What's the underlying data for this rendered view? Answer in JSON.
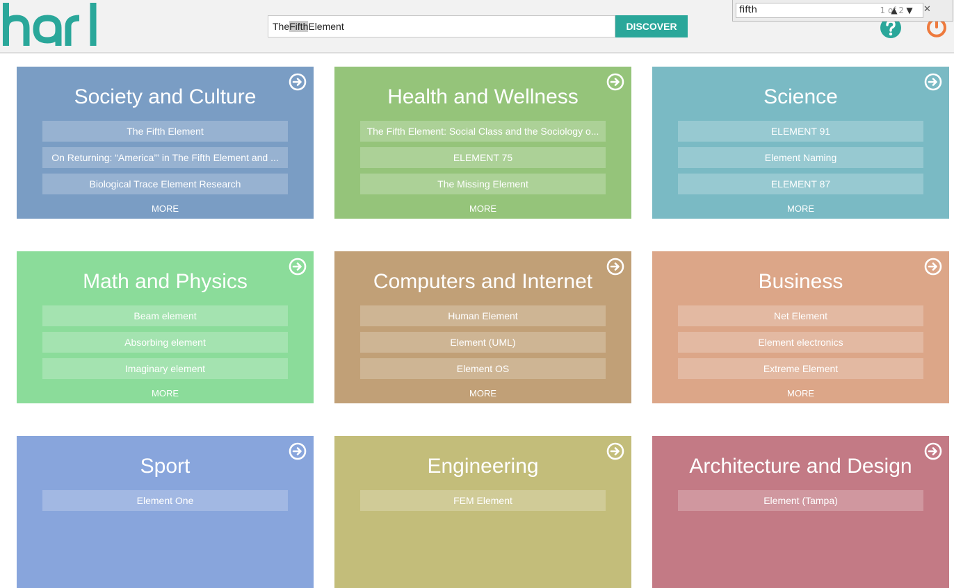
{
  "colors": {
    "brand": "#2aa79a",
    "power": "#ee7a3d",
    "cards": [
      "#7a9dc4",
      "#95c47a",
      "#7abac4",
      "#8bdc9a",
      "#c1a077",
      "#dca688",
      "#88a5dc",
      "#c3bd7a",
      "#c37a85"
    ]
  },
  "header": {
    "logo_text": "hari",
    "search_value_before": "The ",
    "search_value_highlight": "Fifth",
    "search_value_after": " Element",
    "discover_label": "DISCOVER",
    "help_icon": "question-circle-icon",
    "power_icon": "power-icon"
  },
  "findbar": {
    "value": "fifth",
    "count": "1 of 2",
    "up": "▲",
    "down": "▼",
    "close": "✕"
  },
  "cards": [
    {
      "title": "Society and Culture",
      "items": [
        "The Fifth Element",
        "On Returning: “America’” in The Fifth Element and ...",
        "Biological Trace Element Research"
      ],
      "more": "MORE"
    },
    {
      "title": "Health and Wellness",
      "items": [
        "The Fifth Element: Social Class and the Sociology o...",
        "ELEMENT 75",
        "The Missing Element"
      ],
      "more": "MORE"
    },
    {
      "title": "Science",
      "items": [
        "ELEMENT 91",
        "Element Naming",
        "ELEMENT 87"
      ],
      "more": "MORE"
    },
    {
      "title": "Math and Physics",
      "items": [
        "Beam element",
        "Absorbing element",
        "Imaginary element"
      ],
      "more": "MORE"
    },
    {
      "title": "Computers and Internet",
      "items": [
        "Human Element",
        "Element (UML)",
        "Element OS"
      ],
      "more": "MORE"
    },
    {
      "title": "Business",
      "items": [
        "Net Element",
        "Element electronics",
        "Extreme Element"
      ],
      "more": "MORE"
    },
    {
      "title": "Sport",
      "items": [
        "Element One"
      ],
      "more": ""
    },
    {
      "title": "Engineering",
      "items": [
        "FEM Element"
      ],
      "more": ""
    },
    {
      "title": "Architecture and Design",
      "items": [
        "Element (Tampa)"
      ],
      "more": ""
    }
  ]
}
